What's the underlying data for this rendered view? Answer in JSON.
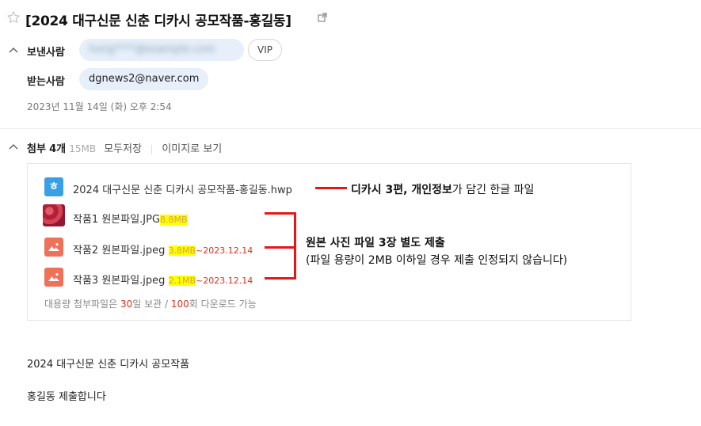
{
  "header": {
    "subject": "[2024 대구신문 신춘 디카시 공모작품-홍길동]"
  },
  "sender": {
    "label": "보낸사람",
    "email": "hong****@example.com",
    "vip_label": "VIP"
  },
  "recipient": {
    "label": "받는사람",
    "email": "dgnews2@naver.com"
  },
  "date": "2023년 11월 14일 (화) 오후 2:54",
  "attachments": {
    "label": "첨부",
    "count": "4개",
    "size": "15MB",
    "save_all": "모두저장",
    "view_images": "이미지로 보기",
    "files": [
      {
        "name": "2024 대구신문 신춘 디카시 공모작품-홍길동.hwp",
        "icon": "hwp-document-icon",
        "icon_char": "ㅎ"
      },
      {
        "name": "작품1 원본파일.JPG",
        "size": "8.8MB",
        "icon": "photo-thumbnail"
      },
      {
        "name": "작품2 원본파일.jpeg",
        "size": "3.8MB",
        "expiry": "~2023.12.14",
        "icon": "image-file-icon"
      },
      {
        "name": "작품3 원본파일.jpeg",
        "size": "2.1MB",
        "expiry": "~2023.12.14",
        "icon": "image-file-icon"
      }
    ],
    "note_prefix": "대용량 첨부파일은 ",
    "note_days": "30",
    "note_mid": "일 보관 / ",
    "note_count": "100",
    "note_suffix": "회 다운로드 가능"
  },
  "annotations": {
    "hwp_bold": "디카시 3편, 개인정보",
    "hwp_rest": "가 담긴 한글 파일",
    "photos_line1": "원본 사진 파일 3장 별도 제출",
    "photos_line2": "(파일 용량이 2MB 이하일 경우 제출 인정되지 않습니다)"
  },
  "body": {
    "line1": "2024 대구신문 신춘 디카시 공모작품",
    "line2": "홍길동 제출합니다"
  },
  "colors": {
    "chip_bg": "#e6effa",
    "highlight": "#ffff00",
    "annotation_red": "#e41818",
    "hwp_icon": "#3aa0e6",
    "image_icon": "#f07159"
  }
}
